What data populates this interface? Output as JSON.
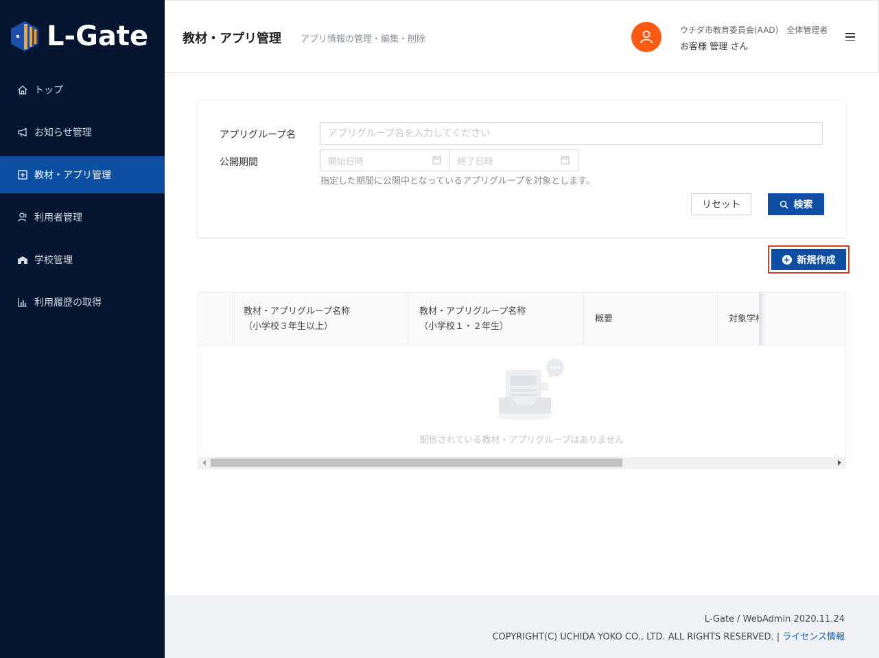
{
  "app": {
    "logo_text": "L-Gate"
  },
  "sidebar": {
    "items": [
      {
        "label": "トップ",
        "icon": "home-icon",
        "active": false
      },
      {
        "label": "お知らせ管理",
        "icon": "megaphone-icon",
        "active": false
      },
      {
        "label": "教材・アプリ管理",
        "icon": "plus-square-icon",
        "active": true
      },
      {
        "label": "利用者管理",
        "icon": "users-icon",
        "active": false
      },
      {
        "label": "学校管理",
        "icon": "school-icon",
        "active": false
      },
      {
        "label": "利用履歴の取得",
        "icon": "bar-chart-icon",
        "active": false
      }
    ]
  },
  "header": {
    "title": "教材・アプリ管理",
    "subtitle": "アプリ情報の管理・編集・削除",
    "user_org": "ウチダ市教育委員会(AAD)　全体管理者",
    "user_name": "お客様 管理 さん",
    "accent_color": "#ff5a14"
  },
  "search": {
    "group_name_label": "アプリグループ名",
    "group_name_placeholder": "アプリグループ名を入力してください",
    "period_label": "公開期間",
    "start_placeholder": "開始日時",
    "end_placeholder": "終了日時",
    "hint": "指定した期間に公開中となっているアプリグループを対象とします。",
    "reset_label": "リセット",
    "search_label": "検索"
  },
  "actions": {
    "new_label": "新規作成"
  },
  "table": {
    "columns": [
      {
        "line1": "",
        "line2": ""
      },
      {
        "line1": "教材・アプリグループ名称",
        "line2": "（小学校３年生以上）"
      },
      {
        "line1": "教材・アプリグループ名称",
        "line2": "（小学校１・２年生）"
      },
      {
        "line1": "概要",
        "line2": ""
      },
      {
        "line1": "対象学校",
        "line2": ""
      }
    ],
    "empty_text": "配信されている教材・アプリグループはありません"
  },
  "footer": {
    "version": "L-Gate / WebAdmin 2020.11.24",
    "copyright": "COPYRIGHT(C) UCHIDA YOKO CO., LTD. ALL RIGHTS RESERVED. | ",
    "license_link": "ライセンス情報"
  },
  "colors": {
    "sidebar_bg": "#061631",
    "primary": "#0b4ea2",
    "highlight_border": "#e0371c"
  }
}
